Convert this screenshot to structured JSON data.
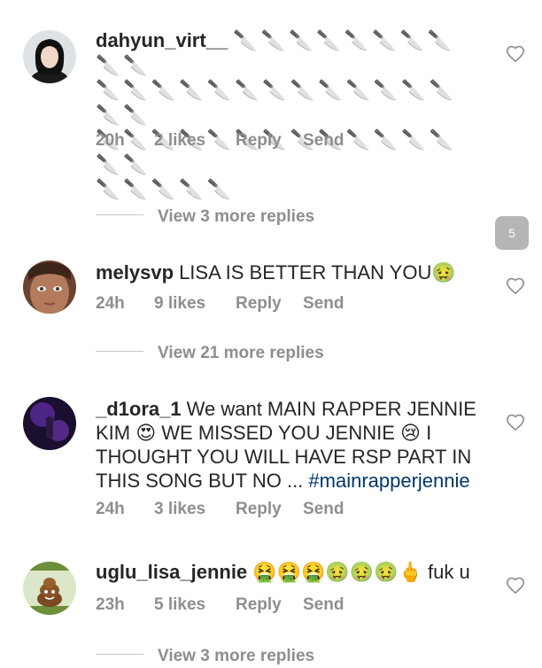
{
  "comments": [
    {
      "username": "dahyun_virt__",
      "text_line1": "🔪🔪🔪🔪🔪🔪🔪🔪🔪🔪",
      "text_line2": "🔪🔪🔪🔪🔪🔪🔪🔪🔪🔪🔪🔪🔪🔪🔪",
      "text_line3": "🔪🔪🔪🔪🔪🔪🔪🔪🔪🔪🔪🔪🔪🔪🔪",
      "text_line4": "🔪🔪🔪🔪🔪",
      "time": "20h",
      "likes": "2 likes",
      "reply": "Reply",
      "send": "Send",
      "view_more": "View 3 more replies"
    },
    {
      "username": "melysvp",
      "text": "LISA IS BETTER THAN YOU🤢",
      "time": "24h",
      "likes": "9 likes",
      "reply": "Reply",
      "send": "Send",
      "view_more": "View 21 more replies"
    },
    {
      "username": "_d1ora_1",
      "text": "We want MAIN RAPPER JENNIE KIM 😍 WE MISSED YOU JENNIE 😢 I THOUGHT YOU WILL HAVE RSP PART IN THIS SONG BUT NO ... ",
      "hashtag": "#mainrapperjennie",
      "time": "24h",
      "likes": "3 likes",
      "reply": "Reply",
      "send": "Send"
    },
    {
      "username": "uglu_lisa_jennie",
      "text": "🤮🤮🤮🤢🤢🤢🖕 fuk u",
      "time": "23h",
      "likes": "5 likes",
      "reply": "Reply",
      "send": "Send",
      "view_more": "View 3 more replies"
    }
  ],
  "badge": "5",
  "icons": {
    "heart": "heart-outline-icon"
  },
  "colors": {
    "text": "#262626",
    "meta": "#8e8e8e",
    "hashtag": "#00376b",
    "badge": "#b5b5b5"
  }
}
